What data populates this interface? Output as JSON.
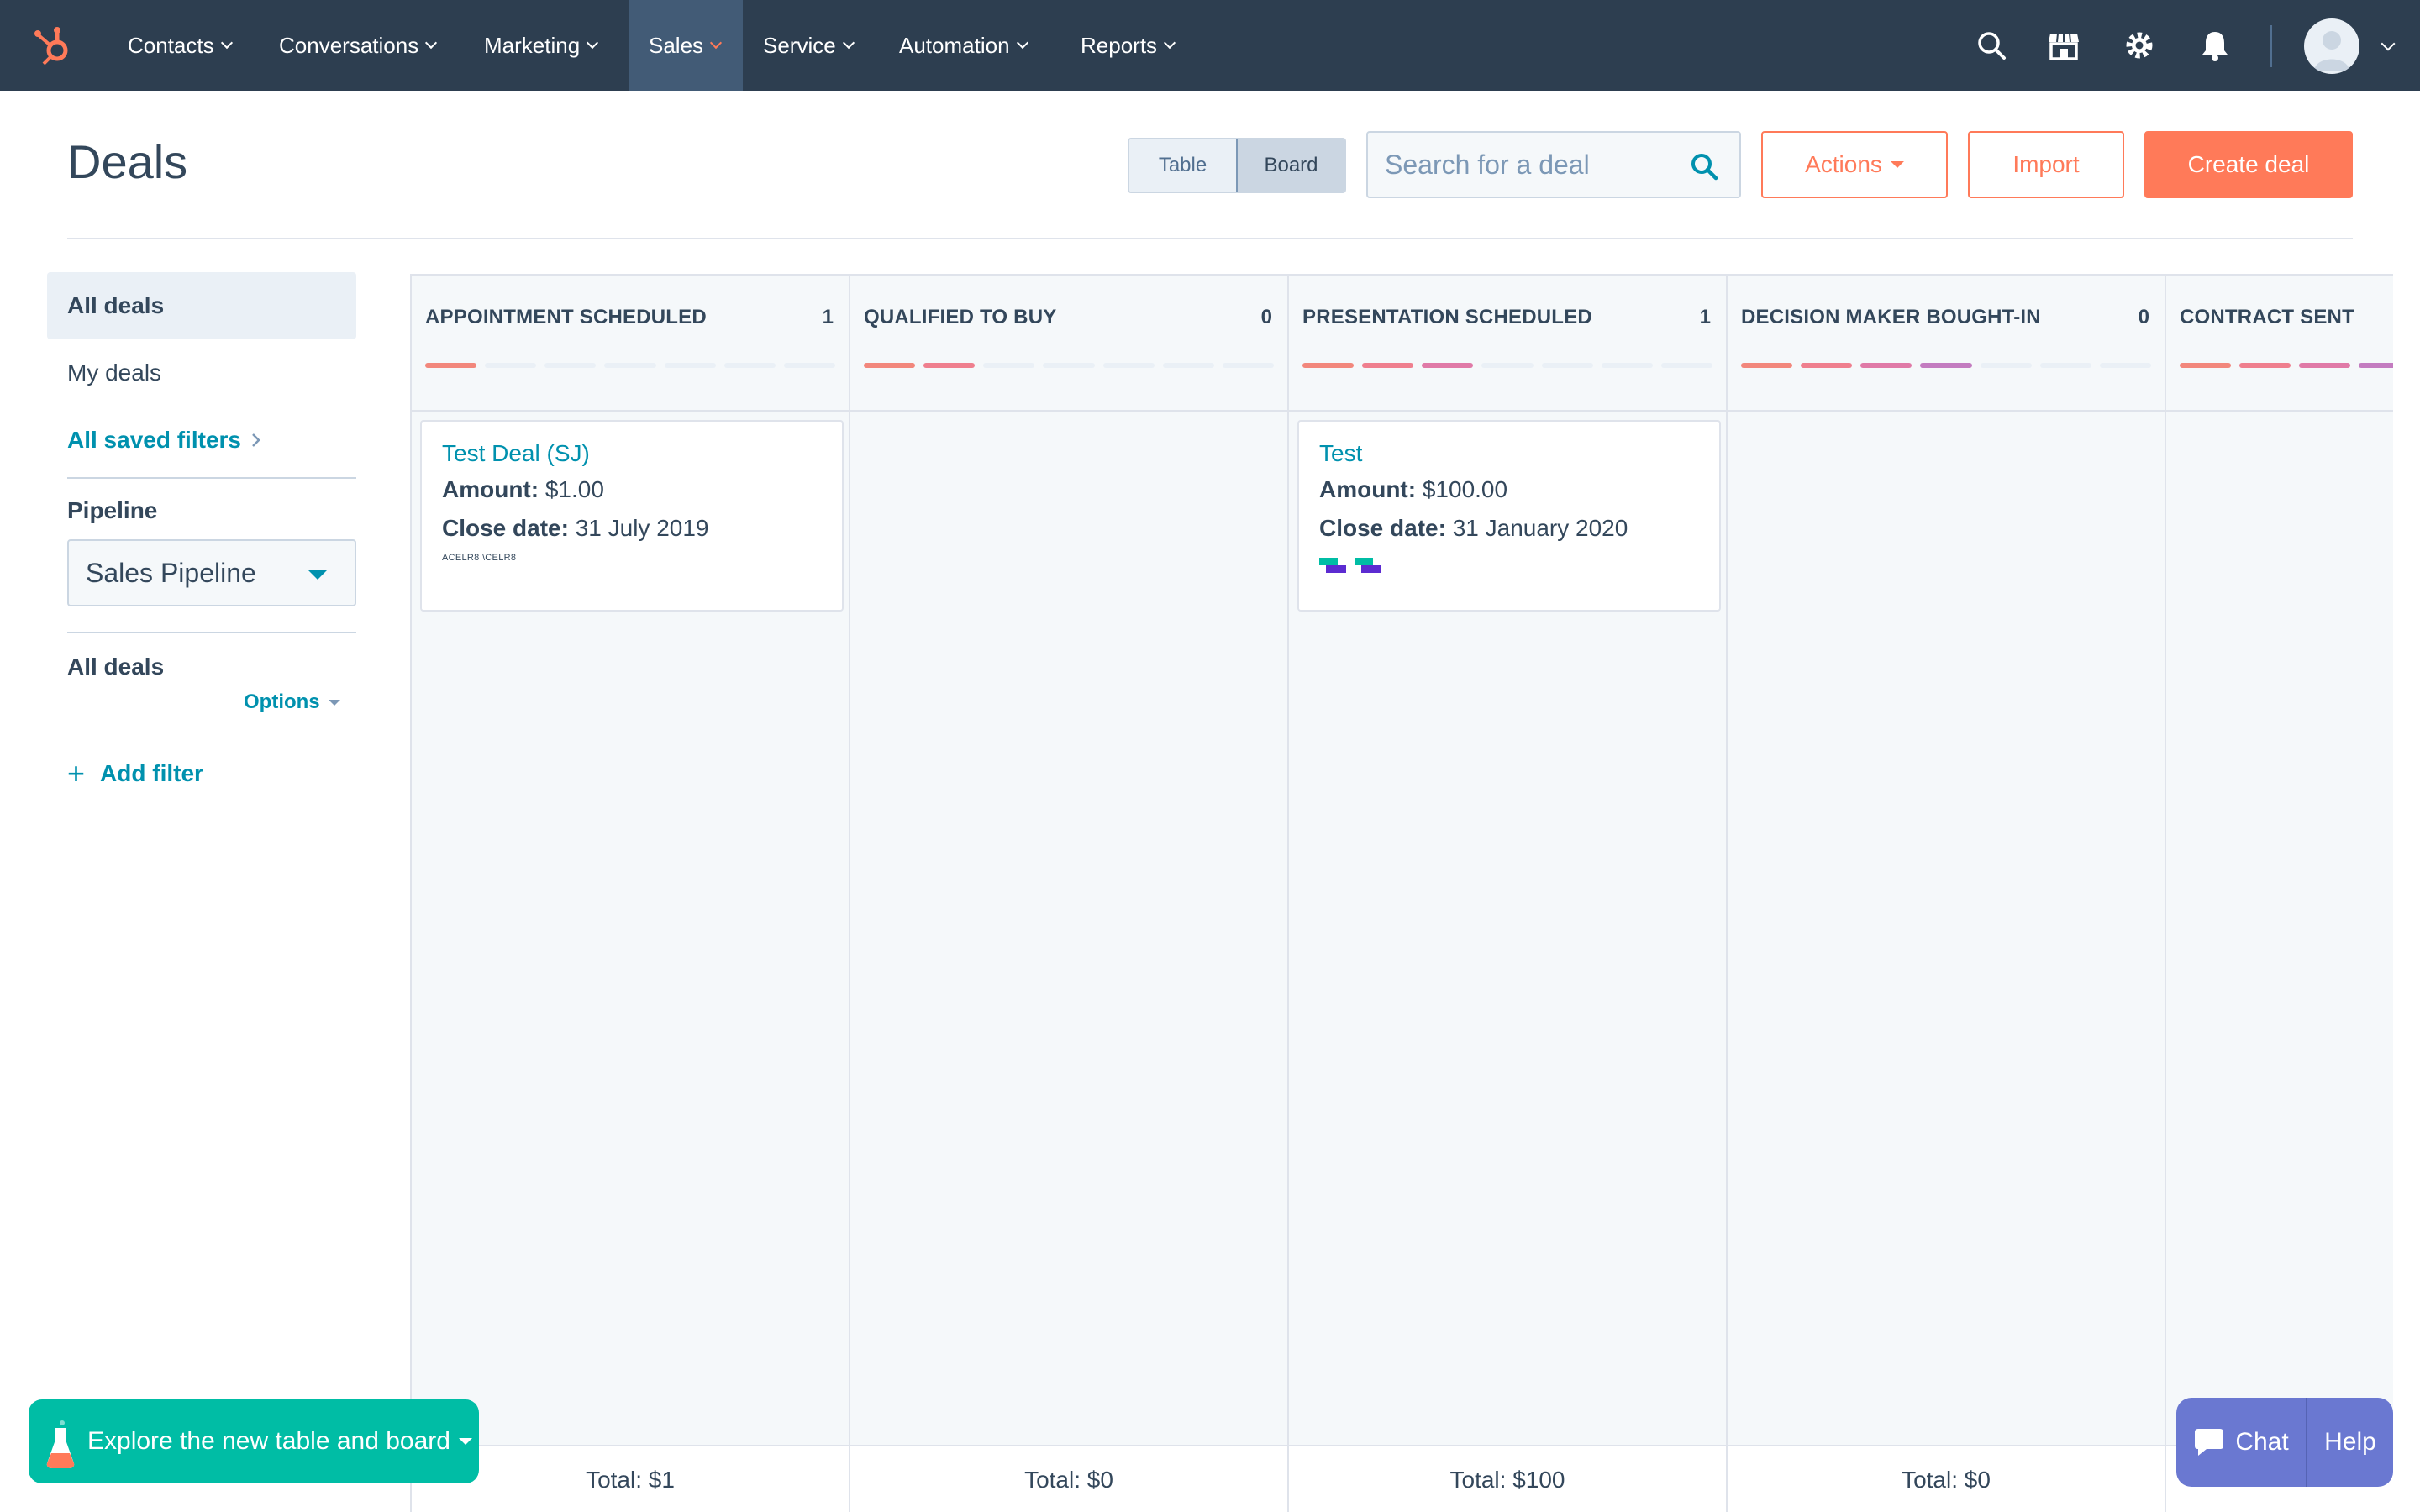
{
  "nav": {
    "items": [
      {
        "label": "Contacts"
      },
      {
        "label": "Conversations"
      },
      {
        "label": "Marketing"
      },
      {
        "label": "Sales"
      },
      {
        "label": "Service"
      },
      {
        "label": "Automation"
      },
      {
        "label": "Reports"
      }
    ],
    "active": "Sales",
    "icons": [
      "search-icon",
      "marketplace-icon",
      "settings-icon",
      "notifications-icon",
      "avatar"
    ]
  },
  "header": {
    "title": "Deals",
    "view_toggle": {
      "table": "Table",
      "board": "Board",
      "selected": "Board"
    },
    "search_placeholder": "Search for a deal",
    "actions_label": "Actions",
    "import_label": "Import",
    "create_label": "Create deal"
  },
  "sidebar": {
    "views": [
      {
        "label": "All deals"
      },
      {
        "label": "My deals"
      }
    ],
    "saved_filters": "All saved filters",
    "pipeline_label": "Pipeline",
    "pipeline_value": "Sales Pipeline",
    "filter_title": "All deals",
    "options_label": "Options",
    "add_filter_label": "Add filter"
  },
  "board": {
    "columns": [
      {
        "title": "APPOINTMENT SCHEDULED",
        "count": "1",
        "progress": 1,
        "total": "Total: $1"
      },
      {
        "title": "QUALIFIED TO BUY",
        "count": "0",
        "progress": 2,
        "total": "Total: $0"
      },
      {
        "title": "PRESENTATION SCHEDULED",
        "count": "1",
        "progress": 3,
        "total": "Total: $100"
      },
      {
        "title": "DECISION MAKER BOUGHT-IN",
        "count": "0",
        "progress": 4,
        "total": "Total: $0"
      },
      {
        "title": "CONTRACT SENT",
        "count": "",
        "progress": 5,
        "total": ""
      }
    ],
    "cards": [
      {
        "name": "Test Deal (SJ)",
        "amount_label": "Amount:",
        "amount": "$1.00",
        "close_label": "Close date:",
        "close_date": "31 July 2019",
        "company_logo_text": "ACELR8 \\CELR8"
      },
      {
        "name": "Test",
        "amount_label": "Amount:",
        "amount": "$100.00",
        "close_label": "Close date:",
        "close_date": "31 January 2020"
      }
    ],
    "progress_colors": [
      "#f2877c",
      "#ef7f8e",
      "#e07aa7",
      "#c37cc0",
      "#a27fd0"
    ]
  },
  "footer": {
    "explore_label": "Explore the new table and board",
    "chat_label": "Chat",
    "help_label": "Help"
  }
}
